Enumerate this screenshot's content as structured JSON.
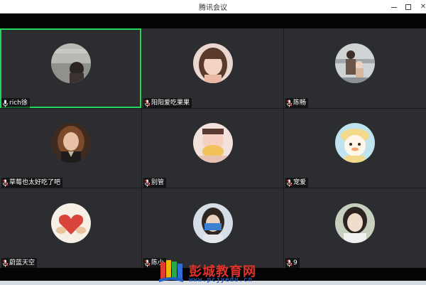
{
  "window": {
    "title": "腾讯会议"
  },
  "participants": [
    {
      "name": "rich徐",
      "active": true,
      "avatar": "gray-photo"
    },
    {
      "name": "阳阳爱吃果果",
      "active": false,
      "avatar": "woman-photo"
    },
    {
      "name": "陈畅",
      "active": false,
      "avatar": "parent-child-photo"
    },
    {
      "name": "草莓也太好吃了吧",
      "active": false,
      "avatar": "hermione-photo"
    },
    {
      "name": "别管",
      "active": false,
      "avatar": "baby-photo"
    },
    {
      "name": "宠爱",
      "active": false,
      "avatar": "cartoon-photo"
    },
    {
      "name": "蔚蓝天空",
      "active": false,
      "avatar": "heart-hands-photo"
    },
    {
      "name": "陈小",
      "active": false,
      "avatar": "phone-selfie-photo"
    },
    {
      "name": "9",
      "active": false,
      "avatar": "girl-photo"
    }
  ],
  "watermark": {
    "brand": "彭城教育网",
    "url": "www.pcjyedu.cn"
  },
  "colors": {
    "active_border": "#22d65e",
    "tile_bg": "#2c2d30",
    "mic": "#e8e8e8"
  }
}
